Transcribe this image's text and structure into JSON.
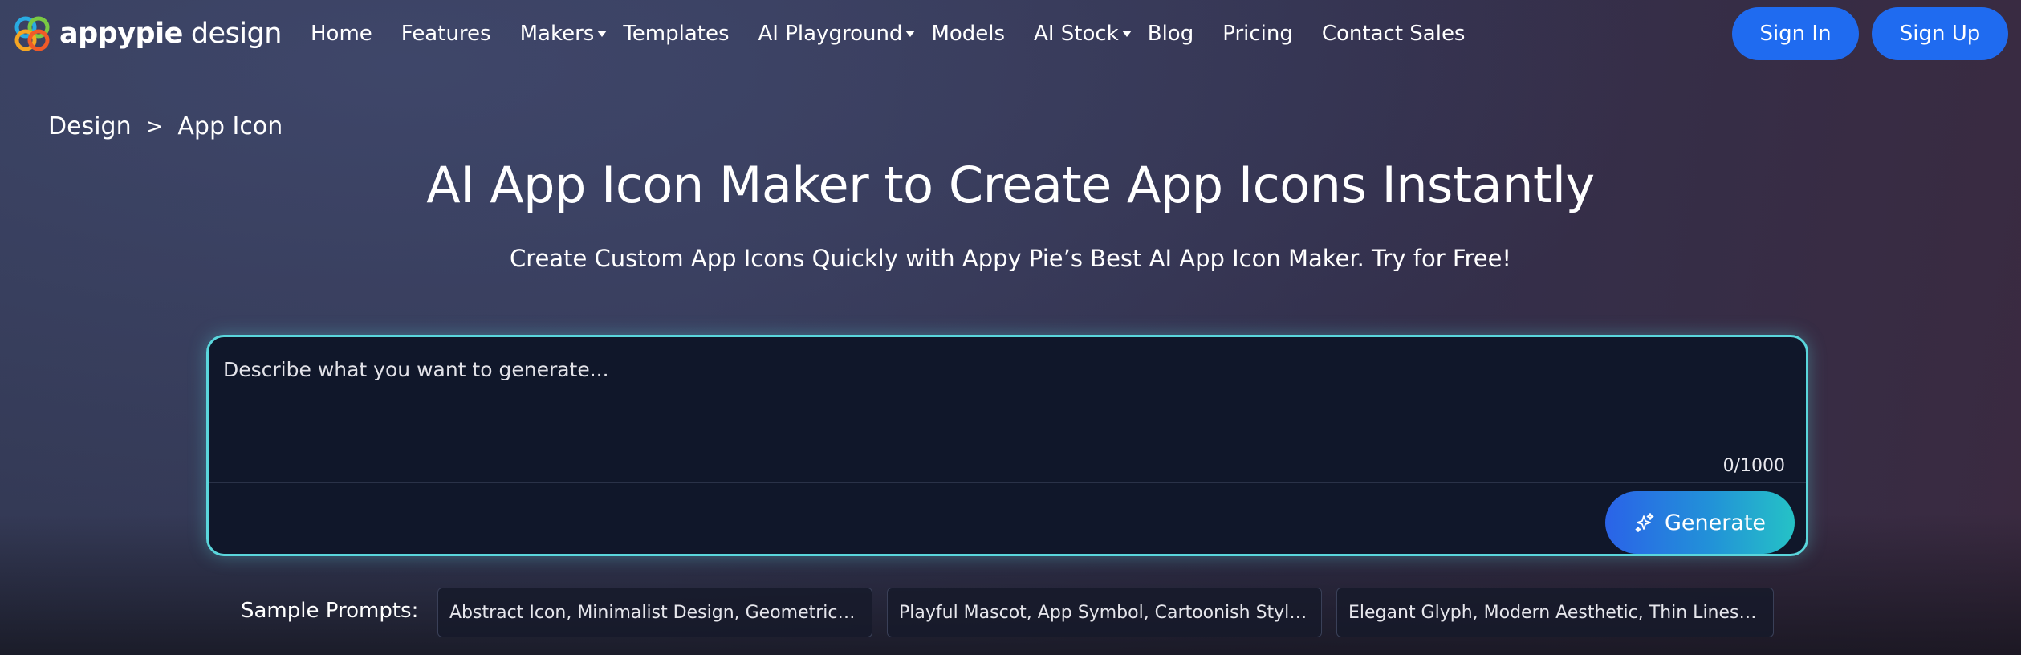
{
  "header": {
    "logo": {
      "brand": "appypie",
      "suffix": "design",
      "colors": [
        "#f5a623",
        "#7ac943",
        "#29abe2",
        "#f05a28"
      ]
    },
    "nav": [
      {
        "label": "Home",
        "dropdown": false
      },
      {
        "label": "Features",
        "dropdown": false
      },
      {
        "label": "Makers",
        "dropdown": true
      },
      {
        "label": "Templates",
        "dropdown": false
      },
      {
        "label": "AI Playground",
        "dropdown": true
      },
      {
        "label": "Models",
        "dropdown": false
      },
      {
        "label": "AI Stock",
        "dropdown": true
      },
      {
        "label": "Blog",
        "dropdown": false
      },
      {
        "label": "Pricing",
        "dropdown": false
      },
      {
        "label": "Contact Sales",
        "dropdown": false
      }
    ],
    "sign_in": "Sign In",
    "sign_up": "Sign Up",
    "button_color": "#1f6bf0"
  },
  "breadcrumb": {
    "parent": "Design",
    "separator": ">",
    "current": "App Icon"
  },
  "hero": {
    "title": "AI App Icon Maker to Create App Icons Instantly",
    "subtitle": "Create Custom App Icons Quickly with Appy Pie’s Best AI App Icon Maker. Try for Free!"
  },
  "prompt": {
    "placeholder": "Describe what you want to generate...",
    "value": "",
    "char_count": "0/1000",
    "generate_label": "Generate",
    "border_color": "#5ad6dc"
  },
  "samples": {
    "label": "Sample Prompts:",
    "items": [
      "Abstract Icon, Minimalist Design, Geometric Sh...",
      "Playful Mascot, App Symbol, Cartoonish Style, ...",
      "Elegant Glyph, Modern Aesthetic, Thin Lines, Pa..."
    ]
  }
}
